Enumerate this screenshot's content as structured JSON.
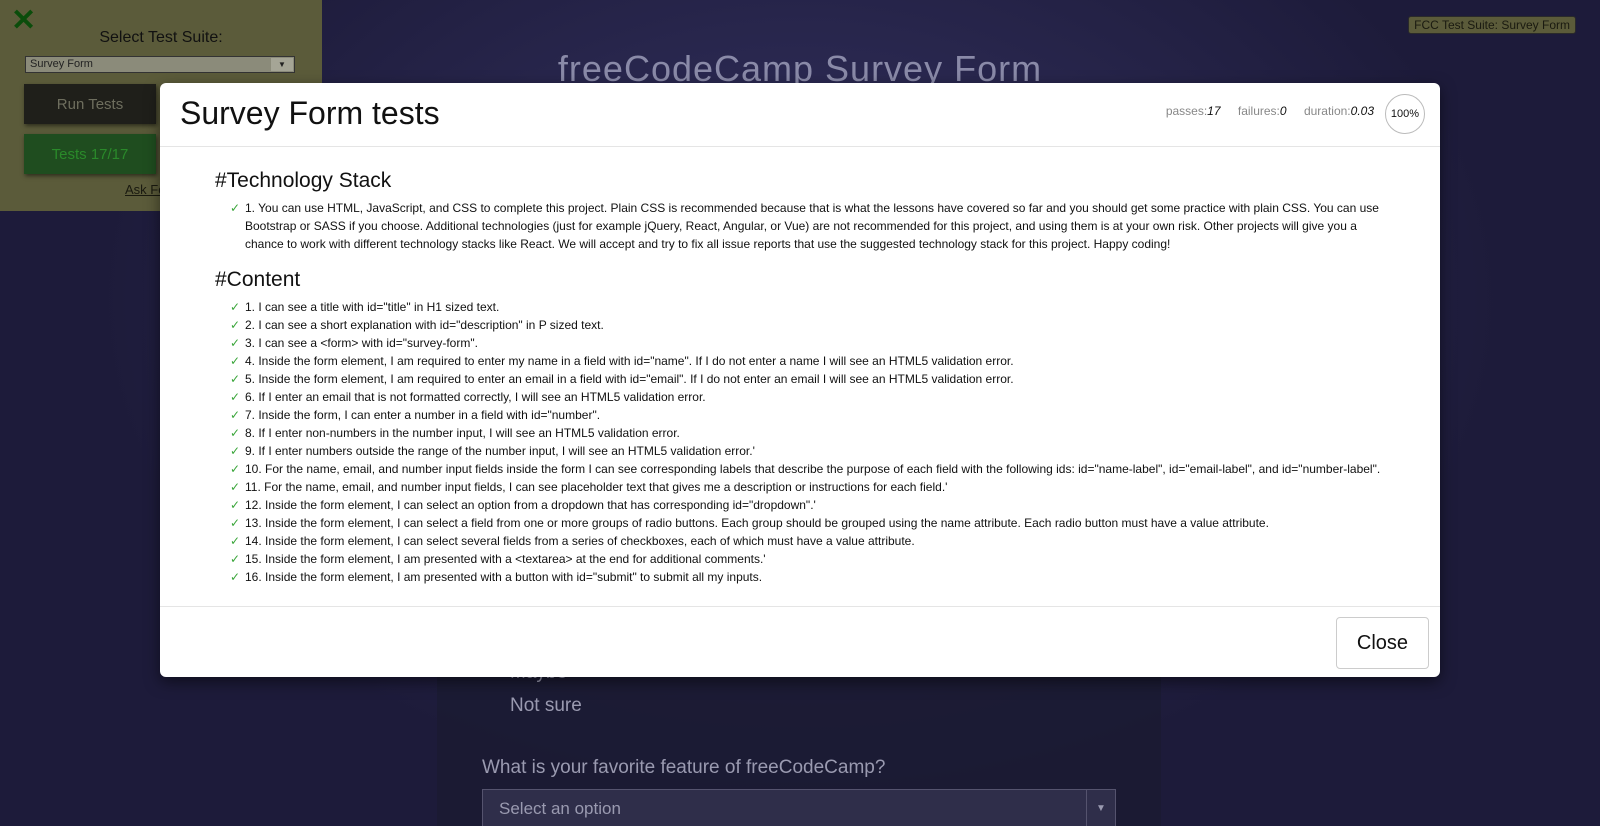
{
  "background": {
    "page_title": "freeCodeCamp Survey Form",
    "options": [
      "Maybe",
      "Not sure"
    ],
    "question": "What is your favorite feature of freeCodeCamp?",
    "select_placeholder": "Select an option"
  },
  "fcc_panel": {
    "select_label": "Select Test Suite:",
    "selected_suite": "Survey Form",
    "run_tests_label": "Run Tests",
    "tests_label": "Tests 17/17",
    "ask_label": "Ask Fo",
    "badge_label": "FCC Test Suite: Survey Form"
  },
  "modal": {
    "title": "Survey Form tests",
    "stats": {
      "passes_label": "passes:",
      "passes": "17",
      "failures_label": "failures:",
      "failures": "0",
      "duration_label": "duration:",
      "duration": "0.03"
    },
    "progress": "100%",
    "check_glyph": "✓",
    "sections": [
      {
        "title": "#Technology Stack",
        "tests": [
          "1. You can use HTML, JavaScript, and CSS to complete this project. Plain CSS is recommended because that is what the lessons have covered so far and you should get some practice with plain CSS. You can use Bootstrap or SASS if you choose. Additional technologies (just for example jQuery, React, Angular, or Vue) are not recommended for this project, and using them is at your own risk. Other projects will give you a chance to work with different technology stacks like React. We will accept and try to fix all issue reports that use the suggested technology stack for this project. Happy coding!"
        ]
      },
      {
        "title": "#Content",
        "tests": [
          "1. I can see a title with id=\"title\" in H1 sized text.",
          "2. I can see a short explanation with id=\"description\" in P sized text.",
          "3. I can see a <form> with id=\"survey-form\".",
          "4. Inside the form element, I am required to enter my name in a field with id=\"name\". If I do not enter a name I will see an HTML5 validation error.",
          "5. Inside the form element, I am required to enter an email in a field with id=\"email\". If I do not enter an email I will see an HTML5 validation error.",
          "6. If I enter an email that is not formatted correctly, I will see an HTML5 validation error.",
          "7. Inside the form, I can enter a number in a field with id=\"number\".",
          "8. If I enter non-numbers in the number input, I will see an HTML5 validation error.",
          "9. If I enter numbers outside the range of the number input, I will see an HTML5 validation error.'",
          "10. For the name, email, and number input fields inside the form I can see corresponding labels that describe the purpose of each field with the following ids: id=\"name-label\", id=\"email-label\", and id=\"number-label\".",
          "11. For the name, email, and number input fields, I can see placeholder text that gives me a description or instructions for each field.'",
          "12. Inside the form element, I can select an option from a dropdown that has corresponding id=\"dropdown\".'",
          "13. Inside the form element, I can select a field from one or more groups of radio buttons. Each group should be grouped using the name attribute. Each radio button must have a value attribute.",
          "14. Inside the form element, I can select several fields from a series of checkboxes, each of which must have a value attribute.",
          "15. Inside the form element, I am presented with a <textarea> at the end for additional comments.'",
          "16. Inside the form element, I am presented with a button with id=\"submit\" to submit all my inputs."
        ]
      }
    ],
    "close_label": "Close"
  }
}
